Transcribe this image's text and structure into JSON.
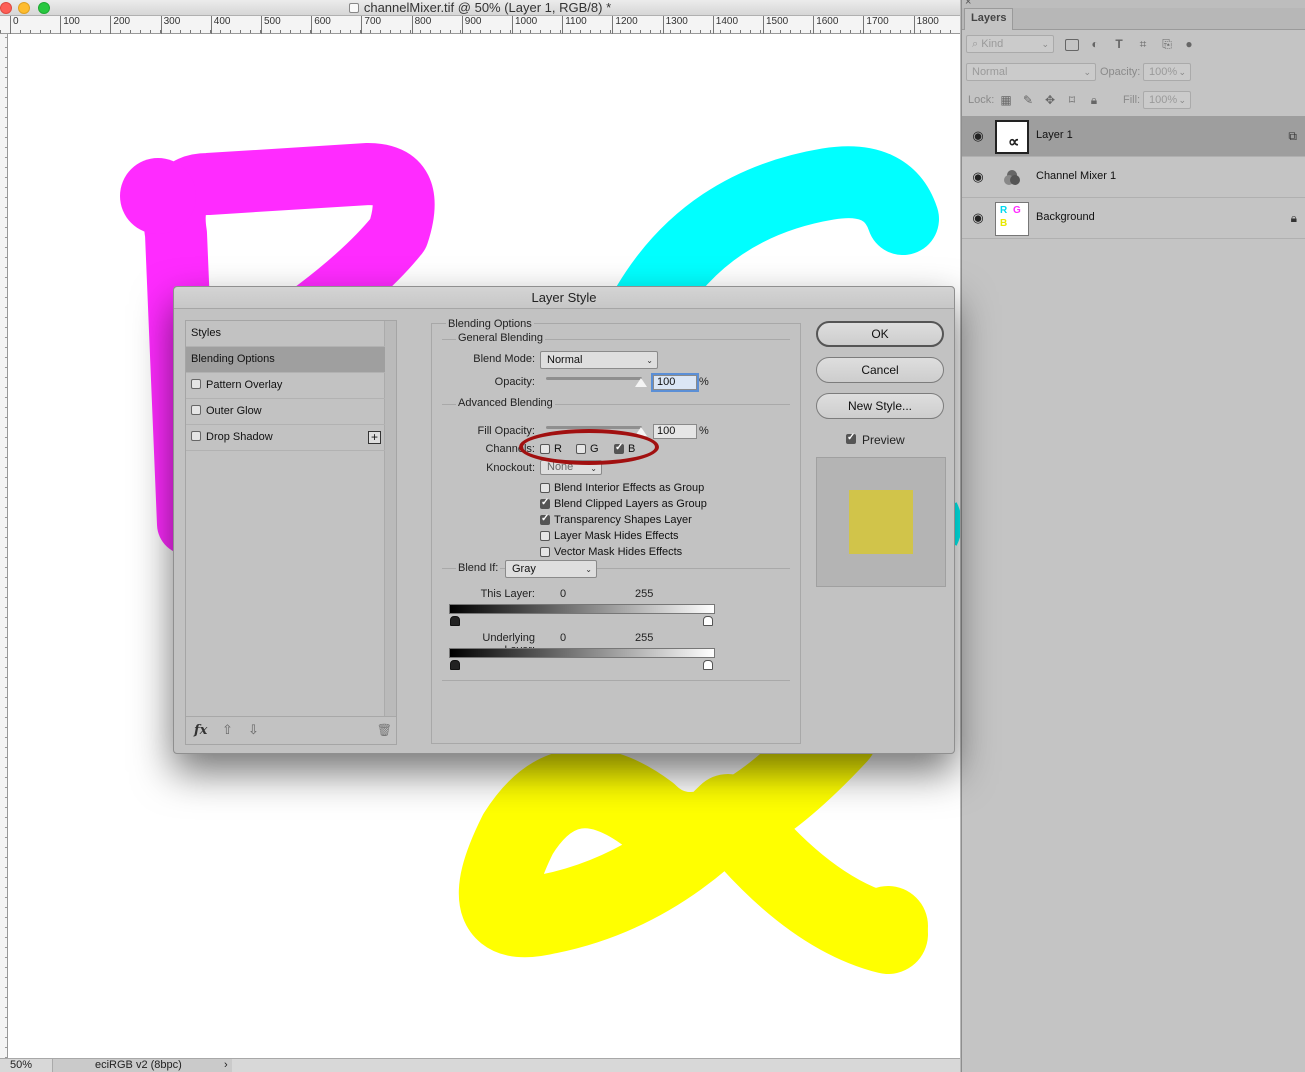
{
  "window": {
    "title": "channelMixer.tif @ 50% (Layer 1, RGB/8) *"
  },
  "ruler": {
    "ticks": [
      "0",
      "100",
      "200",
      "300",
      "400",
      "500",
      "600",
      "700",
      "800",
      "900",
      "1000",
      "1100",
      "1200",
      "1300",
      "1400",
      "1500",
      "1600",
      "1700",
      "1800"
    ]
  },
  "statusbar": {
    "zoom": "50%",
    "profile": "eciRGB v2 (8bpc)",
    "arrow": "›"
  },
  "layers_panel": {
    "tab": "Layers",
    "close": "×",
    "kind_filter": "Kind",
    "blend_mode": "Normal",
    "opacity_label": "Opacity:",
    "opacity_value": "100%",
    "lock_label": "Lock:",
    "fill_label": "Fill:",
    "fill_value": "100%",
    "layers": [
      {
        "name": "Layer 1",
        "thumb_glyph": "∝"
      },
      {
        "name": "Channel Mixer 1"
      },
      {
        "name": "Background",
        "thumb_letters": [
          "R",
          "G",
          "B"
        ]
      }
    ]
  },
  "dialog": {
    "title": "Layer Style",
    "styles_list": {
      "header": "Styles",
      "items": [
        "Blending Options",
        "Pattern Overlay",
        "Outer Glow",
        "Drop Shadow"
      ],
      "footer_fx": "fx"
    },
    "blending": {
      "section_title": "Blending Options",
      "general_title": "General Blending",
      "blend_mode_label": "Blend Mode:",
      "blend_mode_value": "Normal",
      "opacity_label": "Opacity:",
      "opacity_value": "100",
      "percent": "%",
      "advanced_title": "Advanced Blending",
      "fill_opacity_label": "Fill Opacity:",
      "fill_opacity_value": "100",
      "channels_label": "Channels:",
      "channel_r": "R",
      "channel_g": "G",
      "channel_b": "B",
      "knockout_label": "Knockout:",
      "knockout_value": "None",
      "options": [
        {
          "label": "Blend Interior Effects as Group",
          "checked": false
        },
        {
          "label": "Blend Clipped Layers as Group",
          "checked": true
        },
        {
          "label": "Transparency Shapes Layer",
          "checked": true
        },
        {
          "label": "Layer Mask Hides Effects",
          "checked": false
        },
        {
          "label": "Vector Mask Hides Effects",
          "checked": false
        }
      ],
      "blend_if_label": "Blend If:",
      "blend_if_value": "Gray",
      "this_layer_label": "This Layer:",
      "this_layer_min": "0",
      "this_layer_max": "255",
      "underlying_label": "Underlying Layer:",
      "underlying_min": "0",
      "underlying_max": "255"
    },
    "channels_state": {
      "r": false,
      "g": false,
      "b": true
    },
    "buttons": {
      "ok": "OK",
      "cancel": "Cancel",
      "new_style": "New Style..."
    },
    "preview_label": "Preview",
    "preview_checked": true,
    "preview_swatch_color": "#d1c44a"
  },
  "canvas_colors": {
    "magenta": "#ff2bff",
    "cyan": "#00ffff",
    "yellow": "#ffff00"
  },
  "annotation": {
    "color": "#a11010"
  }
}
